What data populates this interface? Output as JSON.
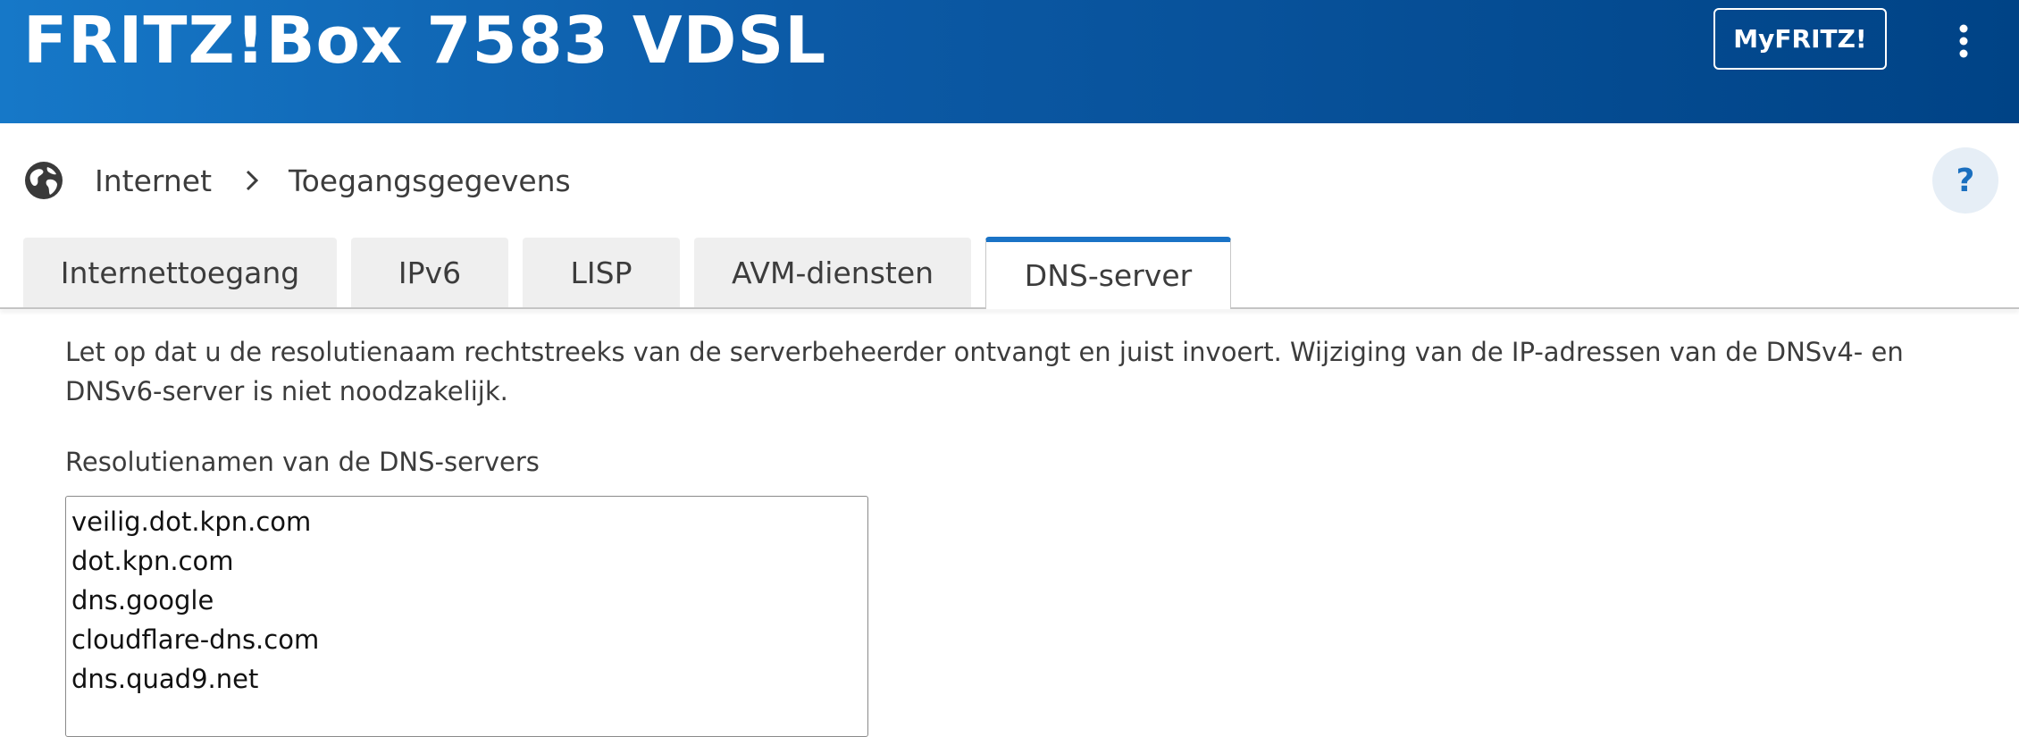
{
  "header": {
    "title": "FRITZ!Box 7583 VDSL",
    "myfritz_label": "MyFRITZ!",
    "menu_icon": "vertical-dots-icon"
  },
  "breadcrumb": {
    "icon": "globe-icon",
    "items": [
      "Internet",
      "Toegangsgegevens"
    ],
    "separator_icon": "chevron-right-icon"
  },
  "help": {
    "label": "?",
    "icon": "help-icon"
  },
  "tabs": [
    {
      "label": "Internettoegang",
      "active": false
    },
    {
      "label": "IPv6",
      "active": false
    },
    {
      "label": "LISP",
      "active": false
    },
    {
      "label": "AVM-diensten",
      "active": false
    },
    {
      "label": "DNS-server",
      "active": true
    }
  ],
  "content": {
    "intro_text": "Let op dat u de resolutienaam rechtstreeks van de serverbeheerder ontvangt en juist invoert. Wijziging van de IP-adressen van de DNSv4- en DNSv6-server is niet noodzakelijk.",
    "field_label": "Resolutienamen van de DNS-servers",
    "dns_names": "veilig.dot.kpn.com\ndot.kpn.com\ndns.google\ncloudflare-dns.com\ndns.quad9.net"
  },
  "colors": {
    "header_gradient_start": "#1678c8",
    "header_gradient_end": "#004386",
    "active_tab_accent": "#1a73c6",
    "help_circle_bg": "#e6eef6"
  }
}
